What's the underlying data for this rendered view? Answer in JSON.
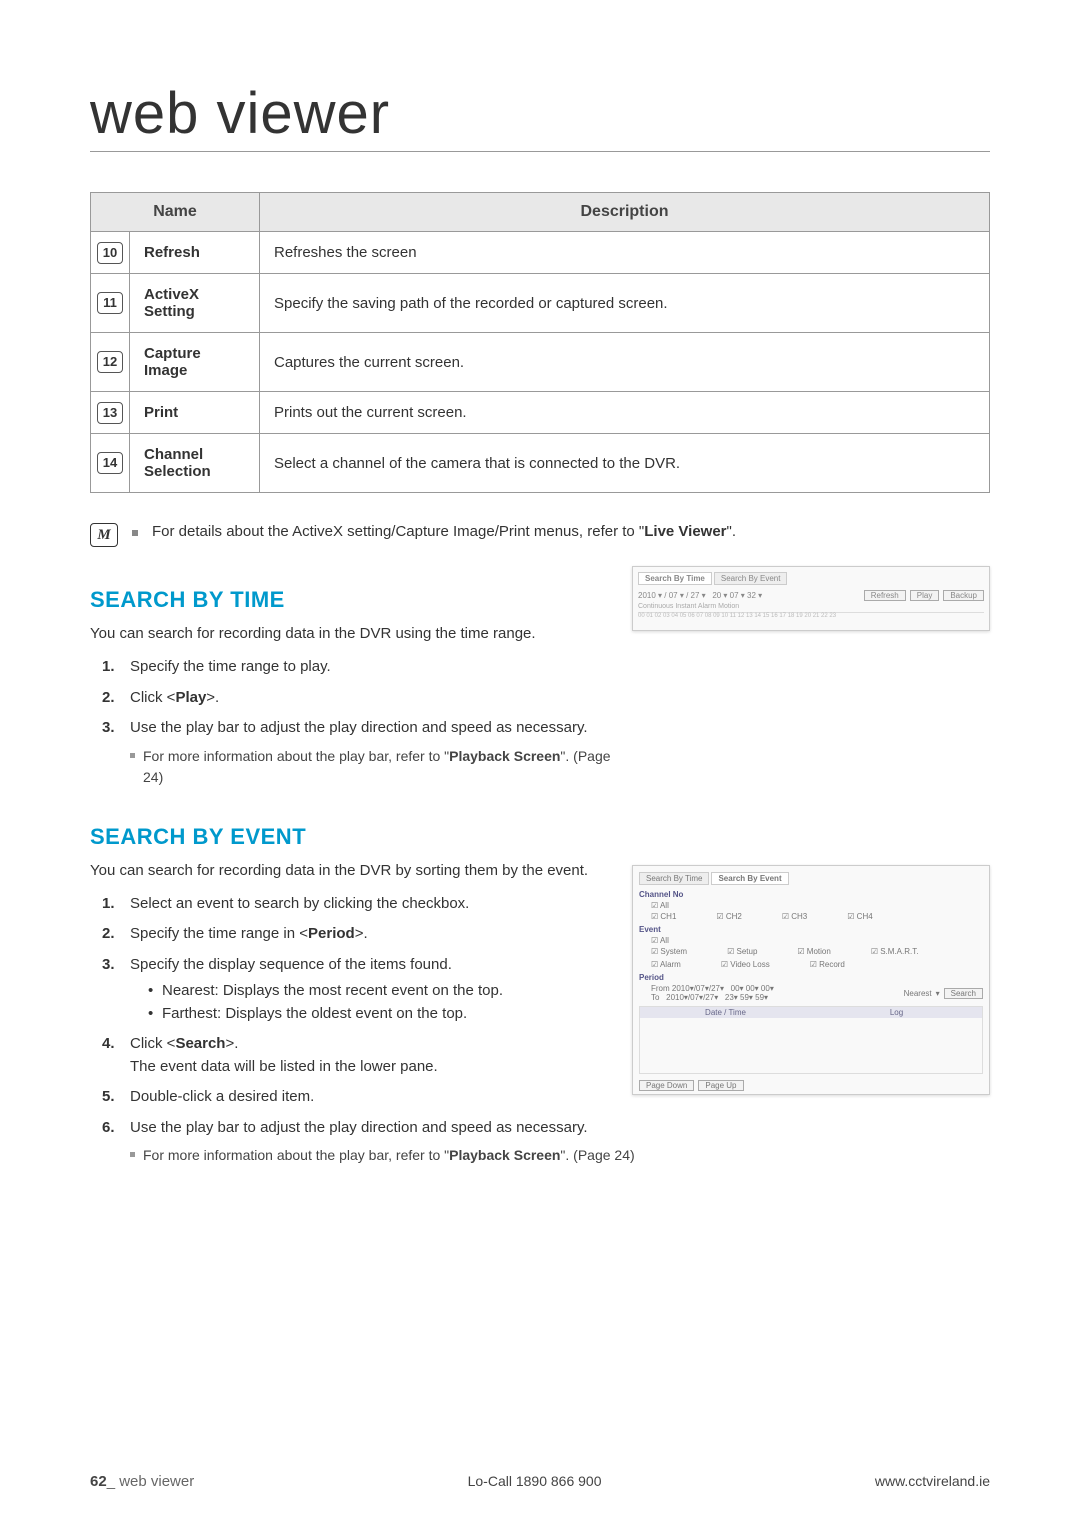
{
  "main_title": "web viewer",
  "table": {
    "head": {
      "name": "Name",
      "desc": "Description"
    },
    "rows": [
      {
        "num": "10",
        "name": "Refresh",
        "desc": "Refreshes the screen"
      },
      {
        "num": "11",
        "name": "ActiveX Setting",
        "desc": "Specify the saving path of the recorded or captured screen."
      },
      {
        "num": "12",
        "name": "Capture Image",
        "desc": "Captures the current screen."
      },
      {
        "num": "13",
        "name": "Print",
        "desc": "Prints out the current screen."
      },
      {
        "num": "14",
        "name": "Channel Selection",
        "desc": "Select a channel of the camera that is connected to the DVR."
      }
    ]
  },
  "note_icon": "M",
  "top_note_prefix": "For details about the ActiveX setting/Capture Image/Print menus, refer to \"",
  "top_note_bold": "Live Viewer",
  "top_note_suffix": "\".",
  "section_time": {
    "title": "SEARCH BY TIME",
    "intro": "You can search for recording data in the DVR using the time range.",
    "steps": [
      {
        "n": "1.",
        "text": "Specify the time range to play."
      },
      {
        "n": "2.",
        "prefix": "Click <",
        "bold": "Play",
        "suffix": ">."
      },
      {
        "n": "3.",
        "text": "Use the play bar to adjust the play direction and speed as necessary."
      }
    ],
    "subnote_prefix": "For more information about the play bar, refer to \"",
    "subnote_bold": "Playback Screen",
    "subnote_suffix": "\". (Page 24)"
  },
  "section_event": {
    "title": "SEARCH BY EVENT",
    "intro": "You can search for recording data in the DVR by sorting them by the event.",
    "steps": [
      {
        "n": "1.",
        "text": "Select an event to search by clicking the checkbox."
      },
      {
        "n": "2.",
        "prefix": "Specify the time range in <",
        "bold": "Period",
        "suffix": ">."
      },
      {
        "n": "3.",
        "text": "Specify the display sequence of the items found.",
        "bullets": [
          "Nearest: Displays the most recent event on the top.",
          "Farthest: Displays the oldest event on the top."
        ]
      },
      {
        "n": "4.",
        "prefix": "Click <",
        "bold": "Search",
        "suffix": ">.",
        "trail": "The event data will be listed in the lower pane."
      },
      {
        "n": "5.",
        "text": "Double-click a desired item."
      },
      {
        "n": "6.",
        "text": "Use the play bar to adjust the play direction and speed as necessary."
      }
    ],
    "subnote_prefix": "For more information about the play bar, refer to \"",
    "subnote_bold": "Playback Screen",
    "subnote_suffix": "\". (Page 24)"
  },
  "sht1": {
    "tab_active": "Search By Time",
    "tab_inactive": "Search By Event",
    "btn_refresh": "Refresh",
    "btn_play": "Play",
    "btn_backup": "Backup",
    "legend": "Continuous  Instant   Alarm   Motion"
  },
  "sht2": {
    "tab_inactive": "Search By Time",
    "tab_active": "Search By Event",
    "label_channel": "Channel No",
    "chk_all": "All",
    "ch": [
      "CH1",
      "CH2",
      "CH3",
      "CH4"
    ],
    "label_event": "Event",
    "events1": [
      "System",
      "Setup",
      "Motion",
      "S.M.A.R.T."
    ],
    "events2": [
      "Alarm",
      "Video Loss",
      "Record"
    ],
    "label_period": "Period",
    "from": "From",
    "to": "To",
    "nearest": "Nearest",
    "btn_search": "Search",
    "thead_date": "Date / Time",
    "thead_log": "Log",
    "btn_pagedown": "Page Down",
    "btn_pageup": "Page Up"
  },
  "footer": {
    "page_num": "62",
    "page_label": "_ web viewer",
    "phone": "Lo-Call  1890 866 900",
    "url": "www.cctvireland.ie"
  }
}
